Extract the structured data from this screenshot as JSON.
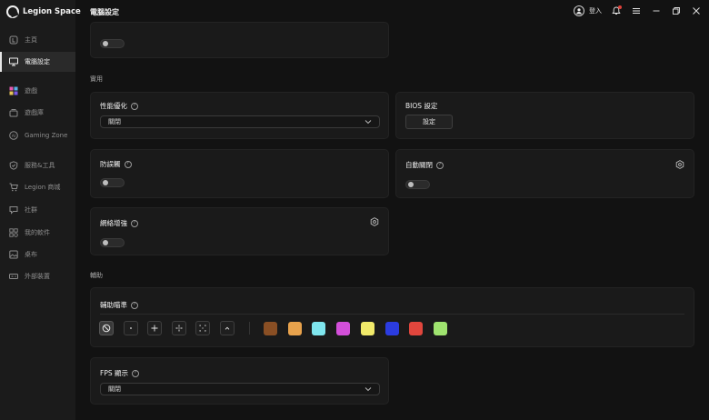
{
  "app": {
    "name": "Legion Space",
    "page_title": "電腦設定"
  },
  "topbar": {
    "login_label": "登入"
  },
  "sidebar": {
    "items": [
      {
        "label": "主頁",
        "icon": "home-icon"
      },
      {
        "label": "電腦設定",
        "icon": "monitor-icon",
        "active": true
      },
      {
        "label": "遊戲",
        "icon": "games-icon"
      },
      {
        "label": "遊戲庫",
        "icon": "library-icon"
      },
      {
        "label": "Gaming Zone",
        "icon": "ai-icon"
      },
      {
        "label": "服務&工具",
        "icon": "shield-icon"
      },
      {
        "label": "Legion 商城",
        "icon": "cart-icon"
      },
      {
        "label": "社群",
        "icon": "community-icon"
      },
      {
        "label": "我的軟件",
        "icon": "apps-icon"
      },
      {
        "label": "桌布",
        "icon": "wallpaper-icon"
      },
      {
        "label": "外部裝置",
        "icon": "device-icon"
      }
    ]
  },
  "sections": {
    "practical": "實用",
    "assist": "輔助"
  },
  "cards": {
    "performance": {
      "title": "性能優化",
      "value": "關閉"
    },
    "bios": {
      "title": "BIOS 設定",
      "button": "設定"
    },
    "anti_touch": {
      "title": "防誤觸"
    },
    "auto_close": {
      "title": "自動關閉"
    },
    "network": {
      "title": "網絡增強"
    },
    "crosshair": {
      "title": "輔助瞄準"
    },
    "fps": {
      "title": "FPS 顯示",
      "value": "關閉"
    }
  },
  "help_glyph": "?",
  "crosshair_swatches": [
    "#8a4f24",
    "#e8a24c",
    "#7fe6ee",
    "#d34fd9",
    "#f1ea6a",
    "#2b3ce0",
    "#e1463d",
    "#9fe36f"
  ]
}
